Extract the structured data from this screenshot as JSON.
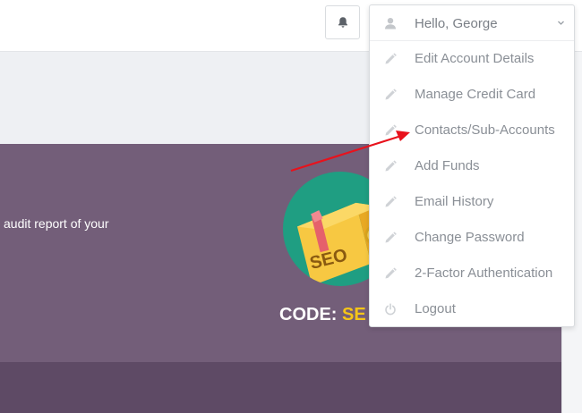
{
  "header": {
    "greeting": "Hello, George"
  },
  "menu": {
    "items": [
      {
        "label": "Edit Account Details",
        "icon": "pencil-icon"
      },
      {
        "label": "Manage Credit Card",
        "icon": "pencil-icon"
      },
      {
        "label": "Contacts/Sub-Accounts",
        "icon": "pencil-icon"
      },
      {
        "label": "Add Funds",
        "icon": "pencil-icon"
      },
      {
        "label": "Email History",
        "icon": "pencil-icon"
      },
      {
        "label": "Change Password",
        "icon": "pencil-icon"
      },
      {
        "label": "2-Factor Authentication",
        "icon": "pencil-icon"
      },
      {
        "label": "Logout",
        "icon": "power-icon"
      }
    ]
  },
  "banner": {
    "text": "audit report of your",
    "promo_badge": "SEO",
    "code_label": "CODE:",
    "code_value": "SE"
  },
  "colors": {
    "banner": "#735e79",
    "banner_dark": "#5e4a65",
    "promo_circle": "#1f9e82",
    "code_value": "#f5c518",
    "arrow": "#e8121c"
  }
}
